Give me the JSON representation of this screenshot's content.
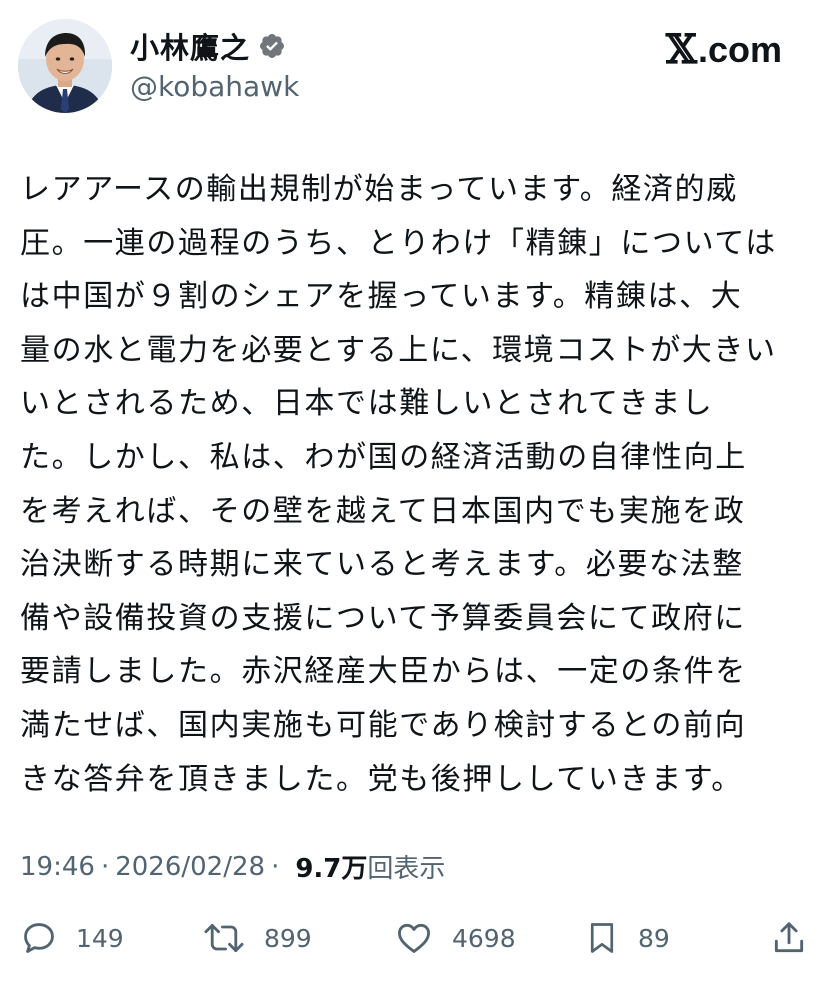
{
  "author": {
    "display_name": "小林鷹之",
    "handle": "@kobahawk",
    "verified_color": "#71767b"
  },
  "brand": {
    "x_symbol": "𝕏",
    "domain": ".com"
  },
  "post": {
    "lines": [
      "レアアースの輸出規制が始まっています。経済的威",
      "圧。一連の過程のうち、とりわけ「精錬」については",
      "は中国が９割のシェアを握っています。精錬は、大",
      "量の水と電力を必要とする上に、環境コストが大きい",
      "いとされるため、日本では難しいとされてきまし",
      "た。しかし、私は、わが国の経済活動の自律性向上",
      "を考えれば、その壁を越えて日本国内でも実施を政",
      "治決断する時期に来ていると考えます。必要な法整",
      "備や設備投資の支援について予算委員会にて政府に",
      "要請しました。赤沢経産大臣からは、一定の条件を",
      "満たせば、国内実施も可能であり検討するとの前向",
      "きな答弁を頂きました。党も後押ししていきます。"
    ]
  },
  "meta": {
    "time": "19:46",
    "separator": "·",
    "date": "2026/02/28",
    "views_count": "9.7万",
    "views_label": "回表示"
  },
  "actions": {
    "replies": "149",
    "reposts": "899",
    "likes": "4698",
    "bookmarks": "89"
  },
  "colors": {
    "text": "#0f1419",
    "secondary": "#536471"
  }
}
